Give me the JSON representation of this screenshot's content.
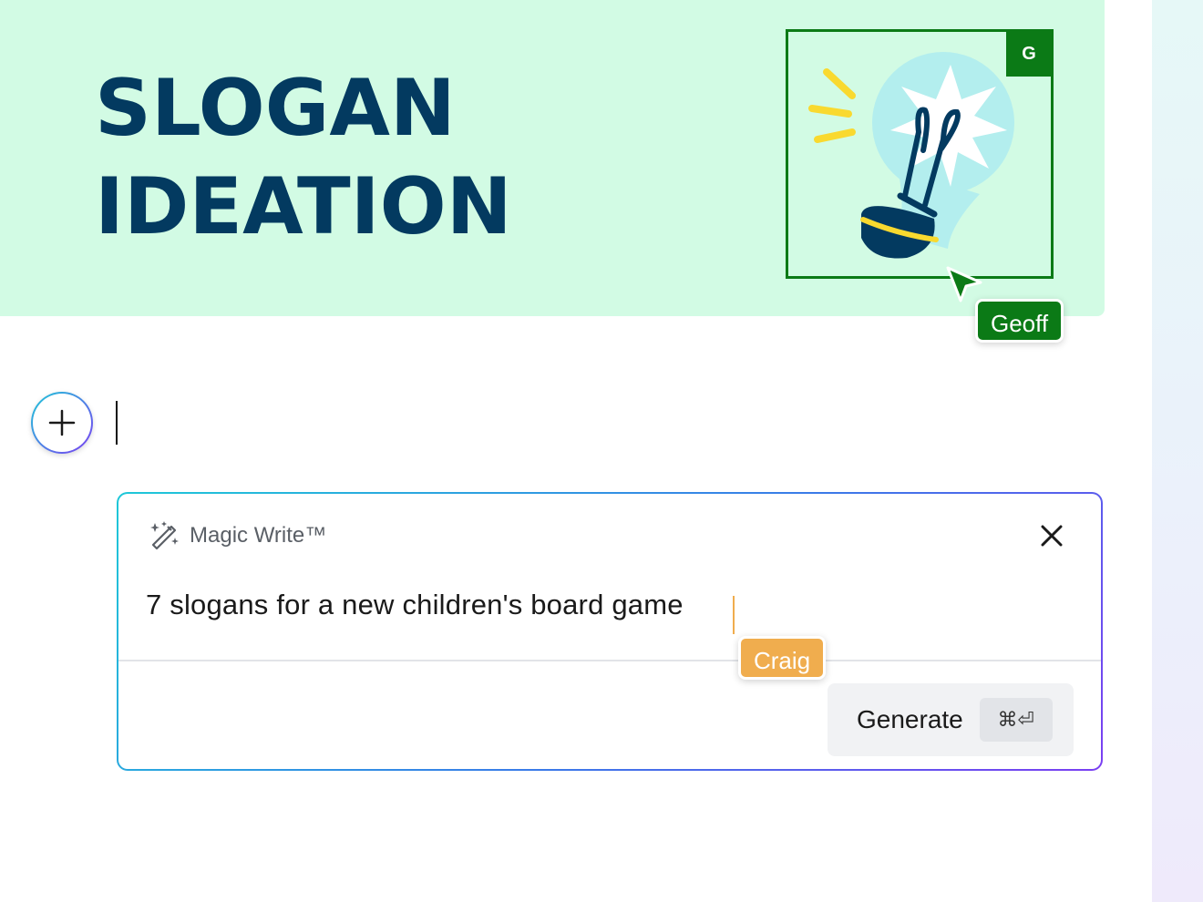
{
  "banner": {
    "title_line1": "SLOGAN",
    "title_line2": "IDEATION",
    "background_color": "#d2fbe4",
    "title_color": "#033a60"
  },
  "selected_image": {
    "icon": "lightbulb-icon",
    "selection_color": "#0b7a16",
    "collaborator_initial": "G"
  },
  "collaborators": {
    "geoff": {
      "name": "Geoff",
      "color": "#0b7a16"
    },
    "craig": {
      "name": "Craig",
      "color": "#f0ad4e"
    }
  },
  "editor": {
    "add_button_icon": "plus-icon"
  },
  "magic_write": {
    "icon": "magic-wand-icon",
    "title": "Magic Write™",
    "close_icon": "close-icon",
    "prompt_text": "7 slogans for a new children's board game",
    "generate_label": "Generate",
    "shortcut": "⌘⏎"
  }
}
